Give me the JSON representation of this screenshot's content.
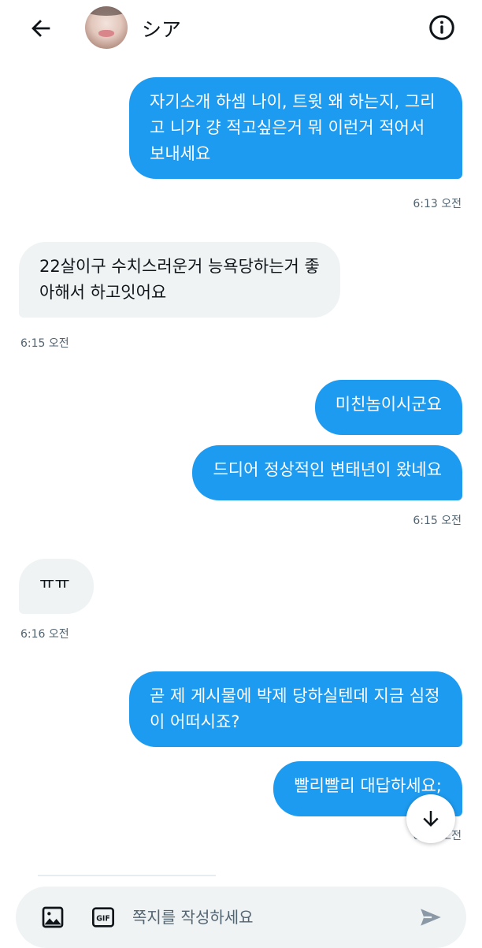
{
  "header": {
    "title": "シア",
    "back_icon": "arrow-left-icon",
    "info_icon": "info-circle-icon"
  },
  "messages": [
    {
      "direction": "out",
      "text": "자기소개 하셈 나이, 트윗 왜 하는지, 그리고 니가 걍 적고싶은거 뭐 이런거 적어서 보내세요",
      "time": "6:13 오전"
    },
    {
      "direction": "in",
      "text": "22살이구 수치스러운거 능욕당하는거 좋아해서 하고잇어요",
      "time": "6:15 오전"
    },
    {
      "direction": "out",
      "text": "미친놈이시군요",
      "time": ""
    },
    {
      "direction": "out",
      "text": "드디어 정상적인 변태년이 왔네요",
      "time": "6:15 오전"
    },
    {
      "direction": "in",
      "text": "ㅠㅠ",
      "time": "6:16 오전"
    },
    {
      "direction": "out",
      "text": "곧 제 게시물에 박제 당하실텐데 지금 심정이 어떠시죠?",
      "time": ""
    },
    {
      "direction": "out",
      "text": "빨리빨리 대답하세요;",
      "time": "6:16 오전"
    }
  ],
  "composer": {
    "placeholder": "쪽지를 작성하세요",
    "value": "",
    "gif_label": "GIF"
  },
  "colors": {
    "accent": "#1d9bf0",
    "incoming_bubble": "#eff3f4",
    "secondary_text": "#536471"
  }
}
